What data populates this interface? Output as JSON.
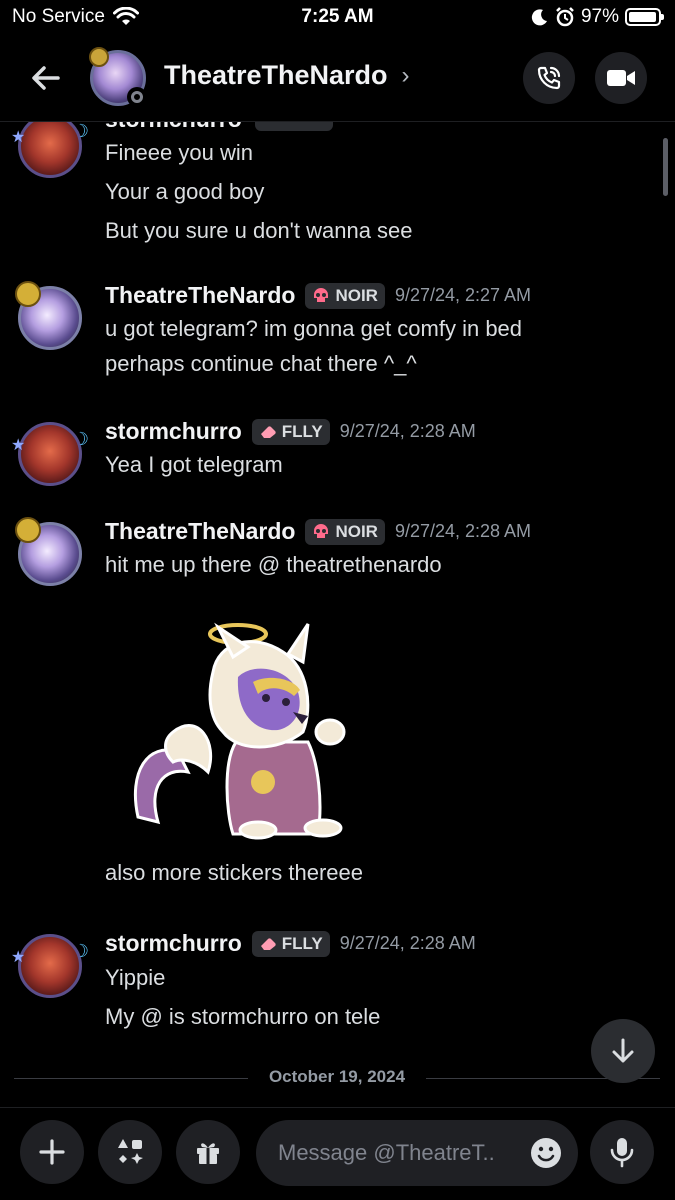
{
  "status_bar": {
    "carrier": "No Service",
    "time": "7:25 AM",
    "battery": "97%",
    "battery_level": 0.97
  },
  "header": {
    "title": "TheatreTheNardo",
    "chevron": "›"
  },
  "messages": [
    {
      "author": "stormchurro",
      "lines": [
        "Fineee you win",
        "Your a good boy",
        "But you sure u don't wanna see"
      ]
    },
    {
      "author": "TheatreTheNardo",
      "tag": "NOIR",
      "tag_icon": "skull",
      "timestamp": "9/27/24, 2:27 AM",
      "lines": [
        "u got telegram? im gonna get comfy in bed",
        "perhaps continue chat there ^_^"
      ]
    },
    {
      "author": "stormchurro",
      "tag": "FLLY",
      "tag_icon": "eraser",
      "timestamp": "9/27/24, 2:28 AM",
      "lines": [
        "Yea I got telegram"
      ]
    },
    {
      "author": "TheatreTheNardo",
      "tag": "NOIR",
      "tag_icon": "skull",
      "timestamp": "9/27/24, 2:28 AM",
      "lines": [
        "hit me up there  @ theatrethenardo",
        "also more stickers thereee"
      ]
    },
    {
      "author": "stormchurro",
      "tag": "FLLY",
      "tag_icon": "eraser",
      "timestamp": "9/27/24, 2:28 AM",
      "lines": [
        "Yippie",
        "My @ is stormchurro on tele"
      ]
    }
  ],
  "date_separator": "October 19, 2024",
  "composer": {
    "placeholder": "Message @TheatreT..",
    "icons": [
      "plus-icon",
      "apps-icon",
      "gift-icon",
      "emoji-icon",
      "microphone-icon"
    ]
  },
  "colors": {
    "background": "#000000",
    "text": "#dbdee1",
    "muted": "#949ba4",
    "tag_bg": "#2b2d31",
    "button_bg": "#1f2024"
  }
}
